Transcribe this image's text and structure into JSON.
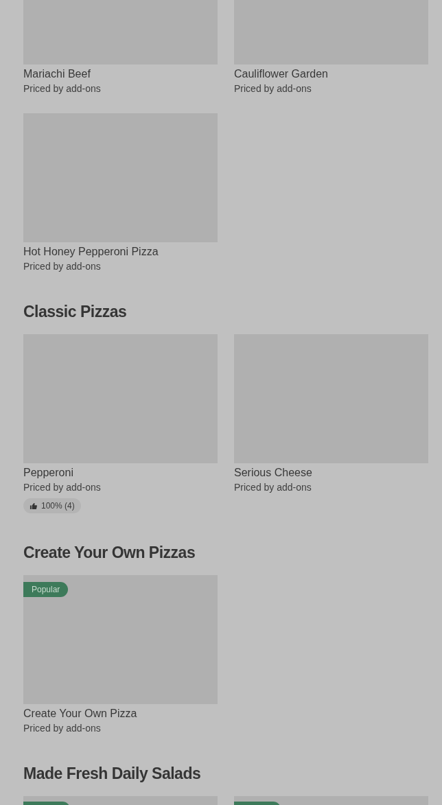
{
  "sections": [
    {
      "items": [
        {
          "name": "Mariachi Beef",
          "price": "Priced by add-ons"
        },
        {
          "name": "Cauliflower Garden",
          "price": "Priced by add-ons"
        },
        {
          "name": "Hot Honey Pepperoni Pizza",
          "price": "Priced by add-ons"
        }
      ]
    },
    {
      "title": "Classic Pizzas",
      "items": [
        {
          "name": "Pepperoni",
          "price": "Priced by add-ons",
          "rating": "100% (4)"
        },
        {
          "name": "Serious Cheese",
          "price": "Priced by add-ons"
        }
      ]
    },
    {
      "title": "Create Your Own Pizzas",
      "items": [
        {
          "name": "Create Your Own Pizza",
          "price": "Priced by add-ons",
          "badge": "Popular"
        }
      ]
    },
    {
      "title": "Made Fresh Daily Salads",
      "items": [
        {
          "badge_cut": true
        },
        {
          "badge_cut": true
        }
      ]
    }
  ]
}
